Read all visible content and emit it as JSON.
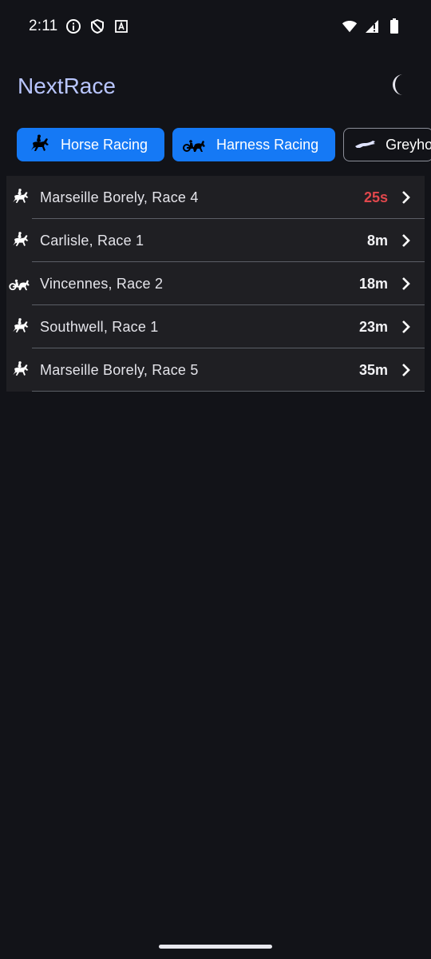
{
  "status_bar": {
    "time": "2:11",
    "icons_left": [
      "info-icon",
      "shield-icon",
      "font-icon"
    ],
    "icons_right": [
      "wifi-icon",
      "signal-icon",
      "battery-icon"
    ]
  },
  "app_bar": {
    "title": "NextRace",
    "theme_toggle_icon": "moon-icon"
  },
  "filters": [
    {
      "label": "Horse Racing",
      "selected": true,
      "icon": "horse-rider-icon"
    },
    {
      "label": "Harness Racing",
      "selected": true,
      "icon": "harness-cart-icon"
    },
    {
      "label": "Greyho",
      "selected": false,
      "icon": "greyhound-icon"
    }
  ],
  "races": [
    {
      "name": "Marseille Borely, Race 4",
      "time": "25s",
      "type": "horse",
      "urgent": true
    },
    {
      "name": "Carlisle, Race 1",
      "time": "8m",
      "type": "horse",
      "urgent": false
    },
    {
      "name": "Vincennes, Race 2",
      "time": "18m",
      "type": "harness",
      "urgent": false
    },
    {
      "name": "Southwell, Race 1",
      "time": "23m",
      "type": "horse",
      "urgent": false
    },
    {
      "name": "Marseille Borely, Race 5",
      "time": "35m",
      "type": "horse",
      "urgent": false
    }
  ],
  "colors": {
    "background": "#121318",
    "title": "#b9c6ff",
    "chip_selected": "#1579f5",
    "list_background": "#1f1f23",
    "urgent_time": "#e0474c"
  }
}
